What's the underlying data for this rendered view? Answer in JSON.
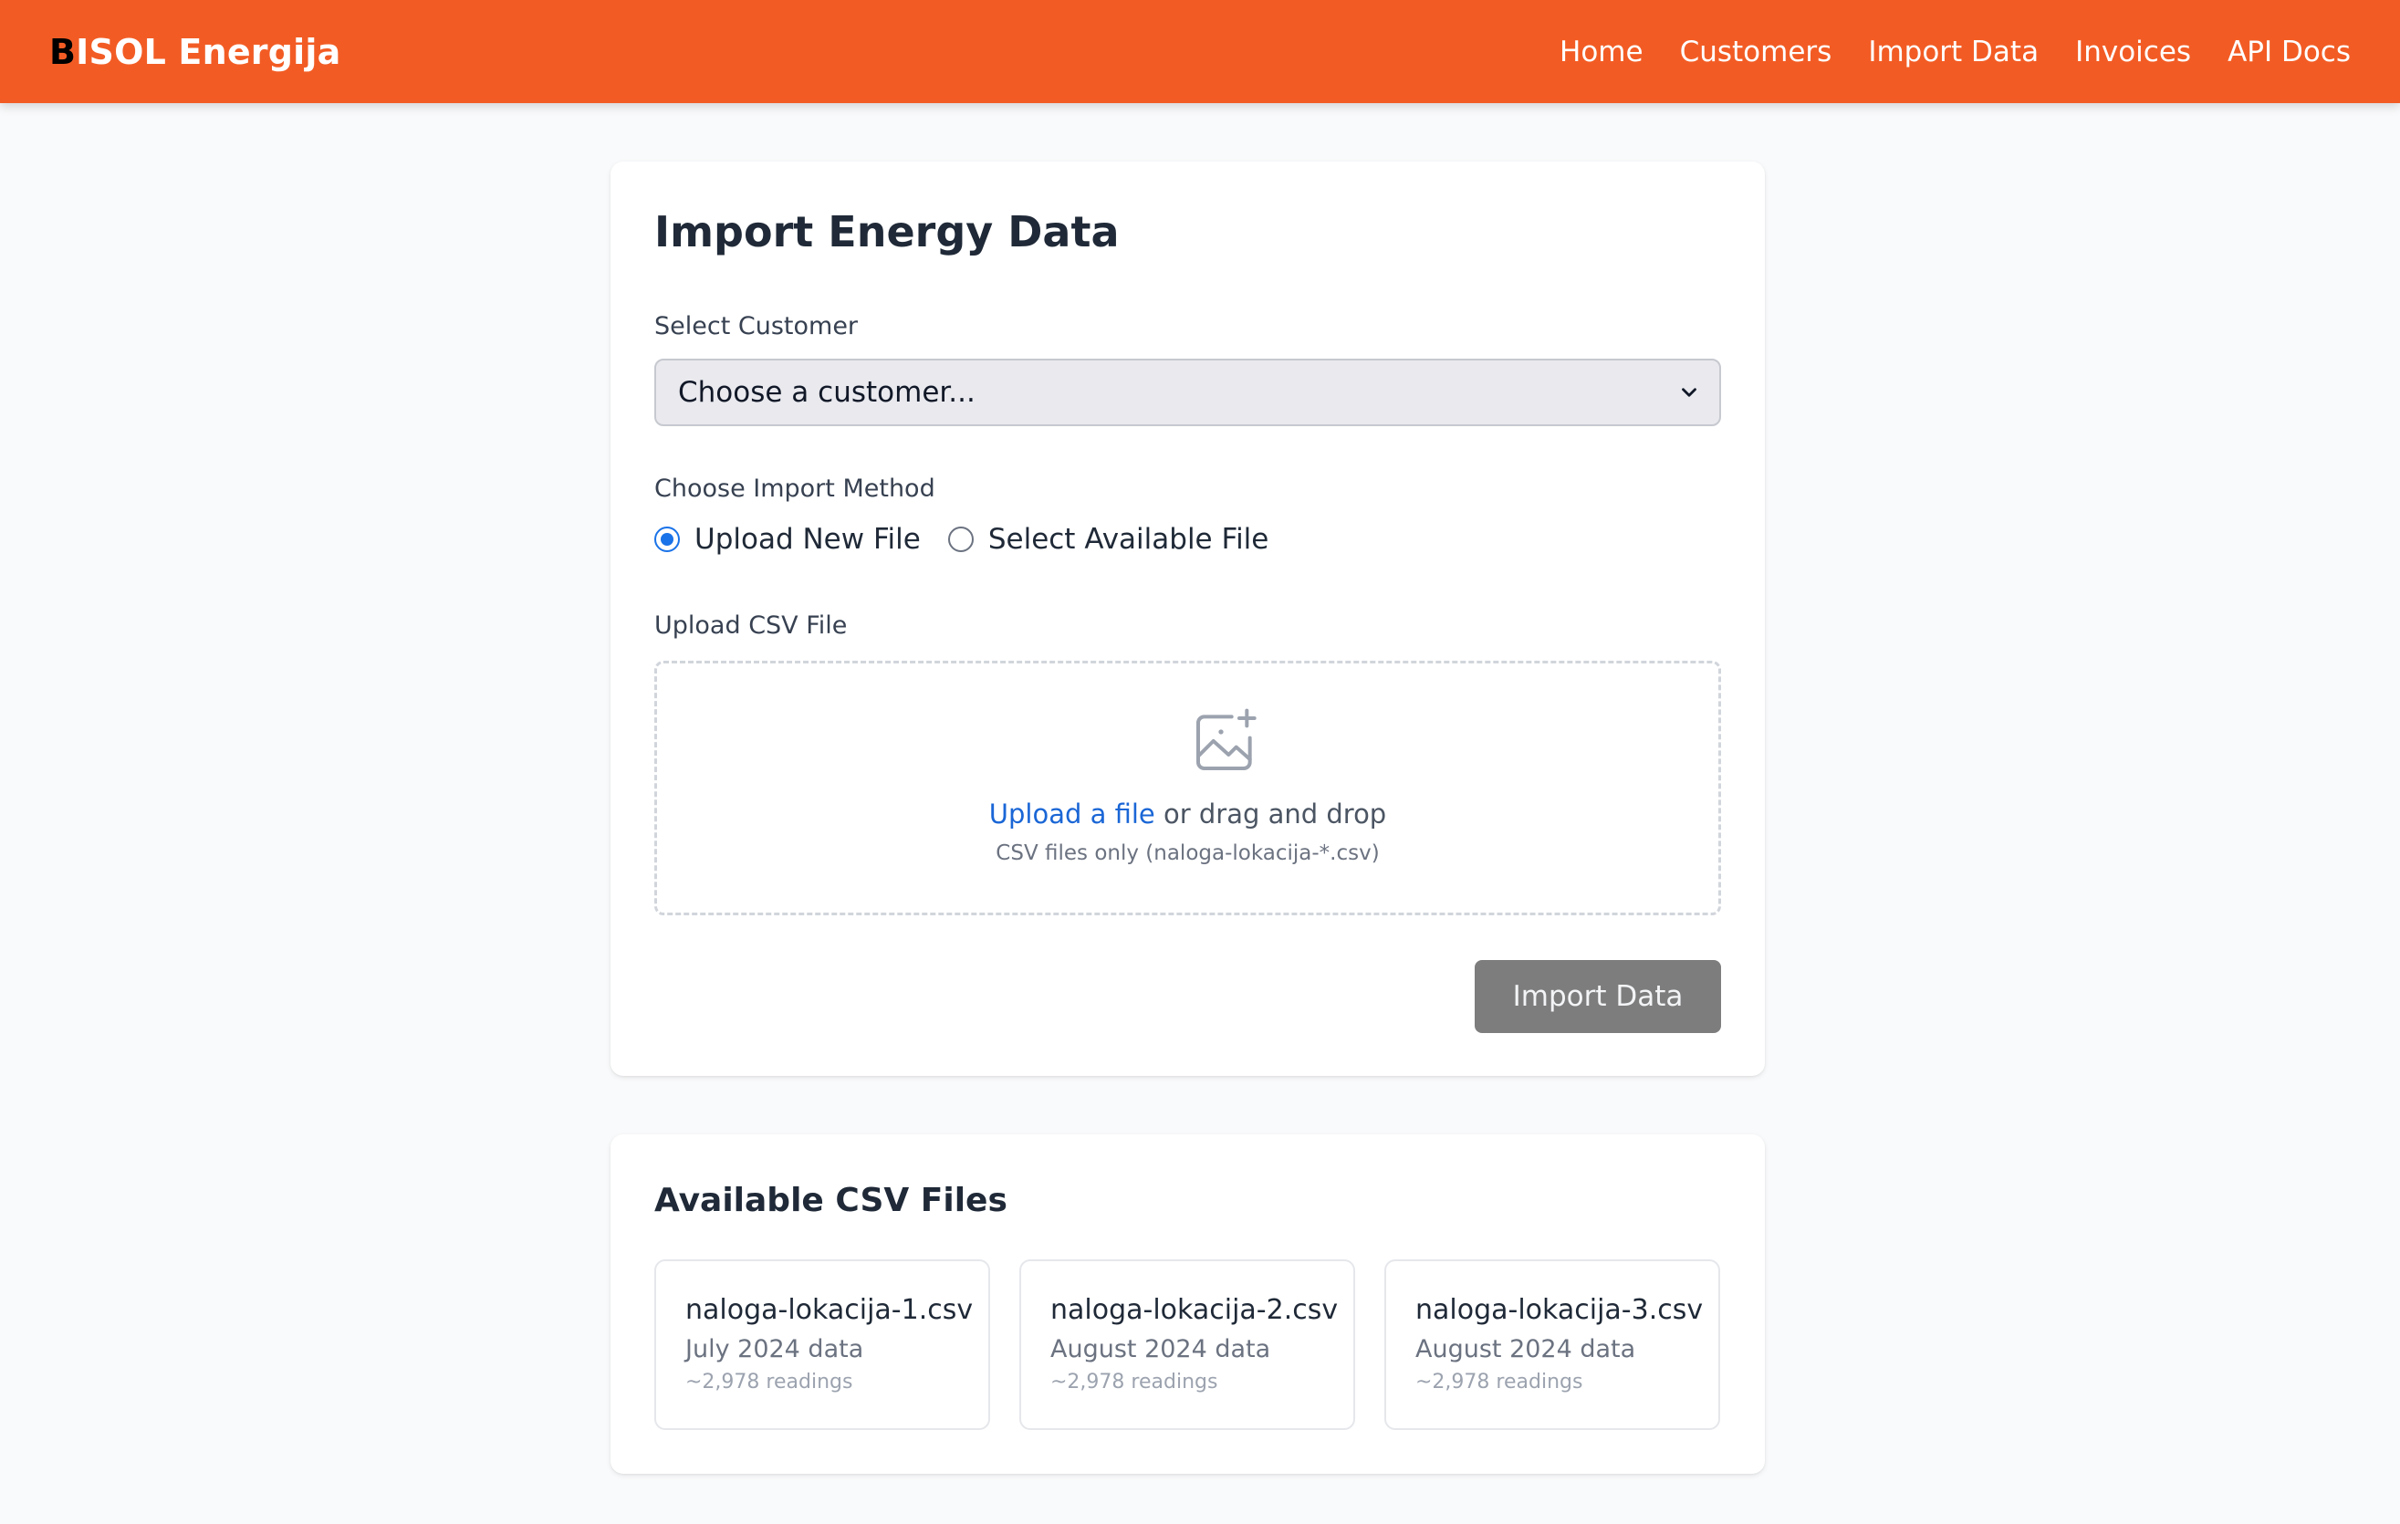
{
  "header": {
    "brand_first": "B",
    "brand_rest": "ISOL Energija",
    "nav": [
      "Home",
      "Customers",
      "Import Data",
      "Invoices",
      "API Docs"
    ]
  },
  "import_card": {
    "title": "Import Energy Data",
    "customer_label": "Select Customer",
    "customer_selected": "Choose a customer...",
    "method_label": "Choose Import Method",
    "method_options": [
      "Upload New File",
      "Select Available File"
    ],
    "method_selected": "Upload New File",
    "upload_label": "Upload CSV File",
    "upload_link": "Upload a file",
    "upload_text": " or drag and drop",
    "upload_hint": "CSV files only (naloga-lokacija-*.csv)",
    "import_button": "Import Data"
  },
  "files_card": {
    "title": "Available CSV Files",
    "files": [
      {
        "name": "naloga-lokacija-1.csv",
        "desc": "July 2024 data",
        "count": "~2,978 readings"
      },
      {
        "name": "naloga-lokacija-2.csv",
        "desc": "August 2024 data",
        "count": "~2,978 readings"
      },
      {
        "name": "naloga-lokacija-3.csv",
        "desc": "August 2024 data",
        "count": "~2,978 readings"
      }
    ]
  },
  "colors": {
    "brand": "#f25c24",
    "link": "#1a66d6",
    "radio_active": "#1a73e8",
    "button_disabled": "#7d7d7d"
  },
  "icons": {
    "upload_icon": "image-plus-icon",
    "select_chevron": "chevron-down-icon"
  }
}
